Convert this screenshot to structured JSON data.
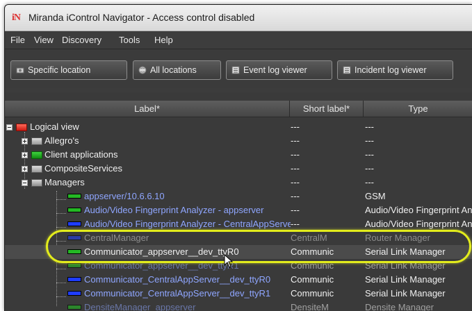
{
  "window": {
    "logo_text": "iN",
    "title": "Miranda iControl Navigator - Access control disabled"
  },
  "menu": [
    "File",
    "View",
    "Discovery",
    "Tools",
    "Help"
  ],
  "toolbar": {
    "specific_location": "Specific location",
    "all_locations": "All locations",
    "event_log_viewer": "Event log viewer",
    "incident_log_viewer": "Incident log viewer"
  },
  "columns": {
    "label": "Label*",
    "short_label": "Short label*",
    "type": "Type"
  },
  "rows": [
    {
      "label": "Logical view",
      "short": "---",
      "type": "---"
    },
    {
      "label": "Allegro's",
      "short": "---",
      "type": "---"
    },
    {
      "label": "Client applications",
      "short": "---",
      "type": "---"
    },
    {
      "label": "CompositeServices",
      "short": "---",
      "type": "---"
    },
    {
      "label": "Managers",
      "short": "---",
      "type": "---"
    },
    {
      "label": "appserver/10.6.6.10",
      "short": "---",
      "type": "GSM"
    },
    {
      "label": "Audio/Video Fingerprint Analyzer - appserver",
      "short": "---",
      "type": "Audio/Video Fingerprint Analyzer"
    },
    {
      "label": "Audio/Video Fingerprint Analyzer - CentralAppServer",
      "short": "---",
      "type": "Audio/Video Fingerprint Analyzer"
    },
    {
      "label": "CentralManager",
      "short": "CentralM",
      "type": "Router Manager"
    },
    {
      "label": "Communicator_appserver__dev_ttyR0",
      "short": "Communic",
      "type": "Serial Link Manager"
    },
    {
      "label": "Communicator_appserver__dev_ttyR1",
      "short": "Communic",
      "type": "Serial Link Manager"
    },
    {
      "label": "Communicator_CentralAppServer__dev_ttyR0",
      "short": "Communic",
      "type": "Serial Link Manager"
    },
    {
      "label": "Communicator_CentralAppServer__dev_ttyR1",
      "short": "Communic",
      "type": "Serial Link Manager"
    },
    {
      "label": "DensiteManager_appserver",
      "short": "DensiteM",
      "type": "Densite Manager"
    }
  ],
  "highlight_color": "#e3ec1c",
  "icons": [
    "application-logo-icon",
    "location-icon",
    "globe-icon",
    "event-log-icon",
    "incident-log-icon",
    "folder-icon",
    "device-icon",
    "mouse-cursor-icon"
  ]
}
